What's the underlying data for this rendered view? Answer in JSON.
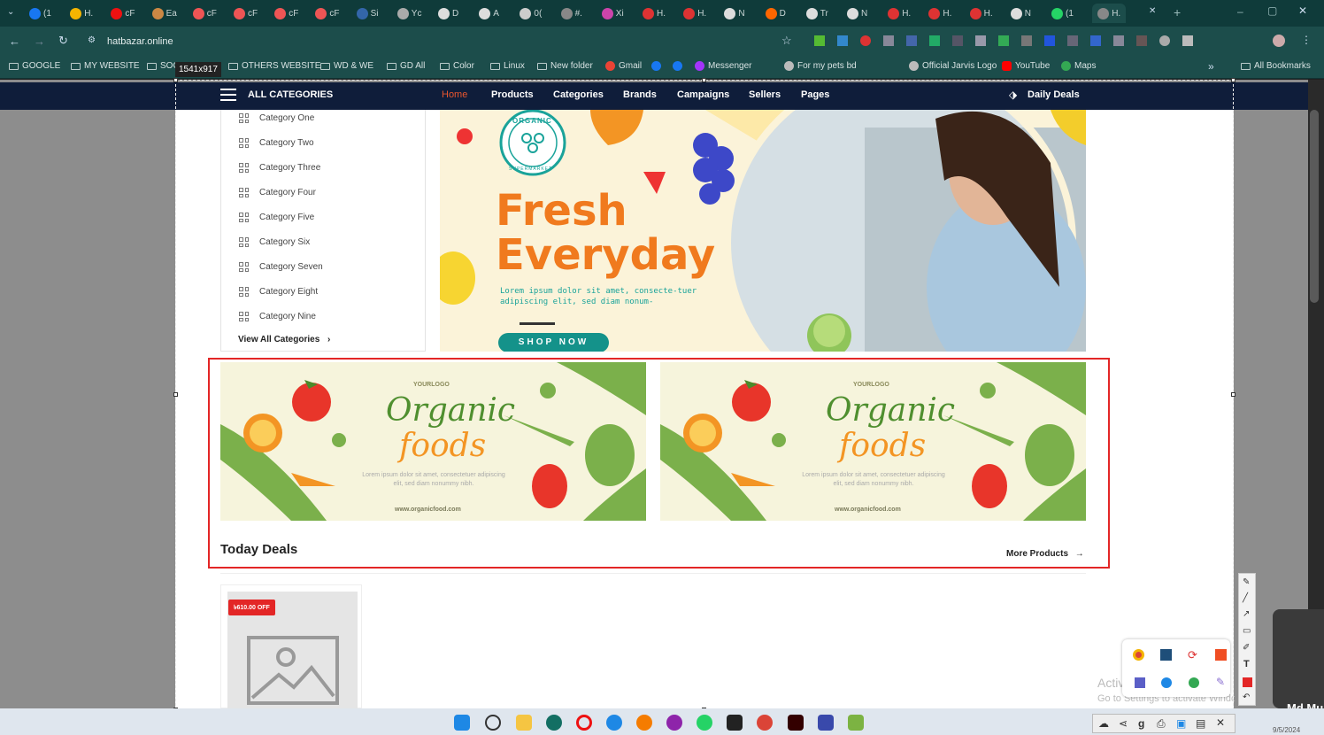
{
  "browser": {
    "tabs": [
      "(1",
      "H.",
      "cF",
      "Ea",
      "cF",
      "cF",
      "cF",
      "cF",
      "Si",
      "Yc",
      "D",
      "A",
      "0(",
      "#.",
      "Xi",
      "H.",
      "H.",
      "N",
      "D",
      "Tr",
      "N",
      "H.",
      "H.",
      "H.",
      "N",
      "(1",
      "H."
    ],
    "url": "hatbazar.online",
    "bookmarks": [
      "GOOGLE",
      "MY WEBSITE",
      "SOC",
      "OTHERS WEBSITE",
      "WD & WE",
      "GD All",
      "Color",
      "Linux",
      "New folder",
      "Gmail",
      "Messenger",
      "For my pets bd",
      "Official Jarvis Logo",
      "YouTube",
      "Maps"
    ],
    "all_bookmarks": "All Bookmarks",
    "overflow": "»"
  },
  "capture": {
    "size_label": "1541x917"
  },
  "site": {
    "all_categories": "ALL CATEGORIES",
    "nav": [
      "Home",
      "Products",
      "Categories",
      "Brands",
      "Campaigns",
      "Sellers",
      "Pages"
    ],
    "daily_deals": "Daily Deals",
    "categories": [
      "Category One",
      "Category Two",
      "Category Three",
      "Category Four",
      "Category Five",
      "Category Six",
      "Category Seven",
      "Category Eight",
      "Category Nine"
    ],
    "view_all": "View All Categories",
    "hero": {
      "badge_top": "ORGANIC",
      "badge_bottom": "SUPERMARKET",
      "title_1": "Fresh",
      "title_2": "Everyday",
      "body": "Lorem ipsum dolor sit amet, consecte-tuer adipiscing elit, sed diam nonum-",
      "button": "SHOP NOW"
    },
    "promo": {
      "logo": "YOURLOGO",
      "title_1": "Organic",
      "title_2": "foods",
      "body": "Lorem ipsum dolor sit amet, consectetuer adipiscing elit, sed diam nonummy nibh.",
      "url": "www.organicfood.com"
    },
    "today_deals": "Today Deals",
    "more_products": "More Products",
    "product_badge": "৳610.00 OFF"
  },
  "os": {
    "watermark_1": "Activate Windows",
    "watermark_2": "Go to Settings to activate Windows.",
    "user": "Md Mu",
    "date": "9/5/2024"
  },
  "colors": {
    "navy": "#0f1d3a",
    "accent": "#e9552e",
    "red": "#e32626",
    "green": "#7bb04b",
    "orange": "#f39524",
    "teal": "#0f3b3a"
  }
}
